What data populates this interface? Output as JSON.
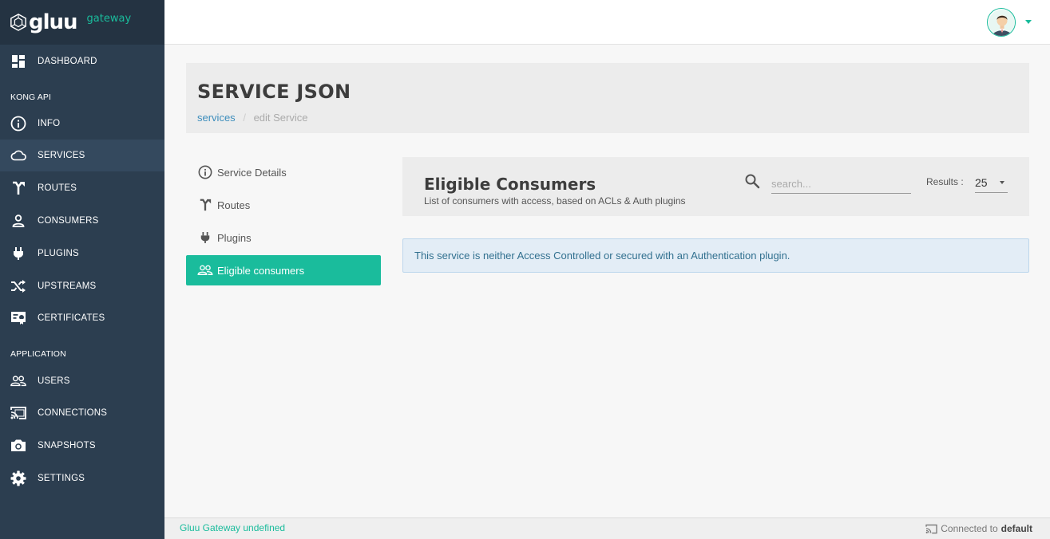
{
  "brand": {
    "name": "gluu",
    "sub": "gateway"
  },
  "sidebar": {
    "dashboard": "DASHBOARD",
    "section_kong": "KONG API",
    "kong_items": [
      {
        "label": "INFO",
        "icon": "info-icon"
      },
      {
        "label": "SERVICES",
        "icon": "cloud-icon"
      },
      {
        "label": "ROUTES",
        "icon": "routes-icon"
      },
      {
        "label": "CONSUMERS",
        "icon": "person-icon"
      },
      {
        "label": "PLUGINS",
        "icon": "plug-icon"
      },
      {
        "label": "UPSTREAMS",
        "icon": "shuffle-icon"
      },
      {
        "label": "CERTIFICATES",
        "icon": "certificate-icon"
      }
    ],
    "section_app": "APPLICATION",
    "app_items": [
      {
        "label": "USERS",
        "icon": "users-icon"
      },
      {
        "label": "CONNECTIONS",
        "icon": "cast-icon"
      },
      {
        "label": "SNAPSHOTS",
        "icon": "camera-icon"
      },
      {
        "label": "SETTINGS",
        "icon": "gear-icon"
      }
    ]
  },
  "header": {
    "title": "SERVICE JSON",
    "breadcrumb": {
      "link": "services",
      "separator": "/",
      "current": "edit Service"
    }
  },
  "tabs": [
    {
      "label": "Service Details",
      "icon": "info-icon"
    },
    {
      "label": "Routes",
      "icon": "routes-icon"
    },
    {
      "label": "Plugins",
      "icon": "plug-icon"
    },
    {
      "label": "Eligible consumers",
      "icon": "users-icon",
      "active": true
    }
  ],
  "consumers_panel": {
    "title": "Eligible Consumers",
    "subtitle": "List of consumers with access, based on ACLs & Auth plugins",
    "search_placeholder": "search...",
    "results_label": "Results :",
    "results_value": "25",
    "alert": "This service is neither Access Controlled or secured with an Authentication plugin."
  },
  "footer": {
    "left": "Gluu Gateway undefined",
    "right_prefix": "Connected to",
    "right_value": "default"
  },
  "colors": {
    "accent": "#1abc9c",
    "sidebar": "#2c3e50",
    "link": "#3c8dbc"
  }
}
